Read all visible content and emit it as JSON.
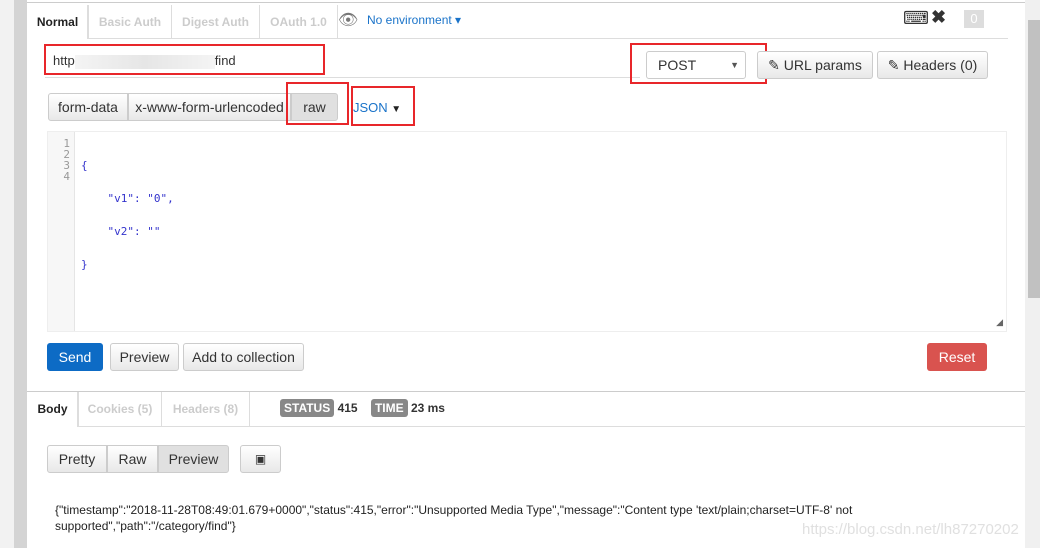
{
  "request_tabs": [
    "Normal",
    "Basic Auth",
    "Digest Auth",
    "OAuth 1.0"
  ],
  "environment": "No environment",
  "notification_count": "0",
  "url": {
    "prefix": "http",
    "suffix": "find"
  },
  "method": "POST",
  "url_params_label": "URL params",
  "headers_label": "Headers (0)",
  "body_modes": [
    "form-data",
    "x-www-form-urlencoded",
    "raw"
  ],
  "raw_type": "JSON",
  "editor": {
    "line_numbers": [
      "1",
      "2",
      "3",
      "4"
    ],
    "lines": [
      "{",
      "    \"v1\": \"0\",",
      "    \"v2\": \"\"",
      "}"
    ]
  },
  "actions": {
    "send": "Send",
    "preview": "Preview",
    "add_to_collection": "Add to collection",
    "reset": "Reset"
  },
  "response_tabs": [
    "Body",
    "Cookies (5)",
    "Headers (8)"
  ],
  "status": {
    "label": "STATUS",
    "value": "415",
    "time_label": "TIME",
    "time_value": "23 ms"
  },
  "view_modes": [
    "Pretty",
    "Raw",
    "Preview"
  ],
  "response_body": "{\"timestamp\":\"2018-11-28T08:49:01.679+0000\",\"status\":415,\"error\":\"Unsupported Media Type\",\"message\":\"Content type 'text/plain;charset=UTF-8' not supported\",\"path\":\"/category/find\"}",
  "watermark": "https://blog.csdn.net/lh87270202",
  "colors": {
    "send": "#0d6bc5",
    "reset": "#d9534f",
    "highlight": "#e8262a",
    "link": "#1a73c9"
  }
}
